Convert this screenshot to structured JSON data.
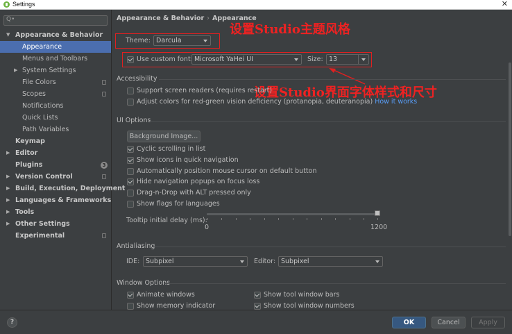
{
  "window": {
    "title": "Settings",
    "close_glyph": "✕"
  },
  "sidebar": {
    "search_glyph": "Q•",
    "items": [
      {
        "label": "Appearance & Behavior",
        "expanded": true,
        "bold": true
      },
      {
        "label": "Appearance",
        "selected": true
      },
      {
        "label": "Menus and Toolbars"
      },
      {
        "label": "System Settings"
      },
      {
        "label": "File Colors",
        "icon": "copy-icon"
      },
      {
        "label": "Scopes",
        "icon": "copy-icon"
      },
      {
        "label": "Notifications"
      },
      {
        "label": "Quick Lists"
      },
      {
        "label": "Path Variables"
      },
      {
        "label": "Keymap",
        "bold": true
      },
      {
        "label": "Editor",
        "bold": true
      },
      {
        "label": "Plugins",
        "bold": true,
        "badge": "3"
      },
      {
        "label": "Version Control",
        "bold": true,
        "icon": "copy-icon"
      },
      {
        "label": "Build, Execution, Deployment",
        "bold": true
      },
      {
        "label": "Languages & Frameworks",
        "bold": true
      },
      {
        "label": "Tools",
        "bold": true
      },
      {
        "label": "Other Settings",
        "bold": true
      },
      {
        "label": "Experimental",
        "bold": true,
        "icon": "copy-icon"
      }
    ]
  },
  "breadcrumb": {
    "parent": "Appearance & Behavior",
    "separator": "›",
    "current": "Appearance"
  },
  "theme": {
    "label": "Theme:",
    "value": "Darcula"
  },
  "font": {
    "checkbox_label": "Use custom font:",
    "checked": true,
    "value": "Microsoft YaHei UI",
    "size_label": "Size:",
    "size_value": "13"
  },
  "accessibility": {
    "title": "Accessibility",
    "screen_readers": "Support screen readers (requires restart)",
    "color_deficiency": "Adjust colors for red-green vision deficiency (protanopia, deuteranopia)",
    "how_link": "How it works"
  },
  "ui_options": {
    "title": "UI Options",
    "background_button": "Background Image...",
    "options": [
      {
        "label": "Cyclic scrolling in list",
        "checked": true
      },
      {
        "label": "Show icons in quick navigation",
        "checked": true
      },
      {
        "label": "Automatically position mouse cursor on default button",
        "checked": false
      },
      {
        "label": "Hide navigation popups on focus loss",
        "checked": true
      },
      {
        "label": "Drag-n-Drop with ALT pressed only",
        "checked": false
      },
      {
        "label": "Show flags for languages",
        "checked": false
      }
    ],
    "tooltip_label": "Tooltip initial delay (ms):",
    "tooltip_min": "0",
    "tooltip_max": "1200",
    "tooltip_value": 1200
  },
  "antialiasing": {
    "title": "Antialiasing",
    "ide_label": "IDE:",
    "ide_value": "Subpixel",
    "editor_label": "Editor:",
    "editor_value": "Subpixel"
  },
  "window_options": {
    "title": "Window Options",
    "animate": "Animate windows",
    "memory": "Show memory indicator",
    "tool_bars": "Show tool window bars",
    "tool_numbers": "Show tool window numbers"
  },
  "annotations": {
    "theme_note": "设置Studio主题风格",
    "font_note": "设置Studio界面字体样式和尺寸"
  },
  "footer": {
    "help": "?",
    "ok": "OK",
    "cancel": "Cancel",
    "apply": "Apply"
  },
  "colors": {
    "background": "#3c3f41",
    "selection": "#4b6eaf",
    "annotation": "#ee2222",
    "link": "#589df6"
  }
}
